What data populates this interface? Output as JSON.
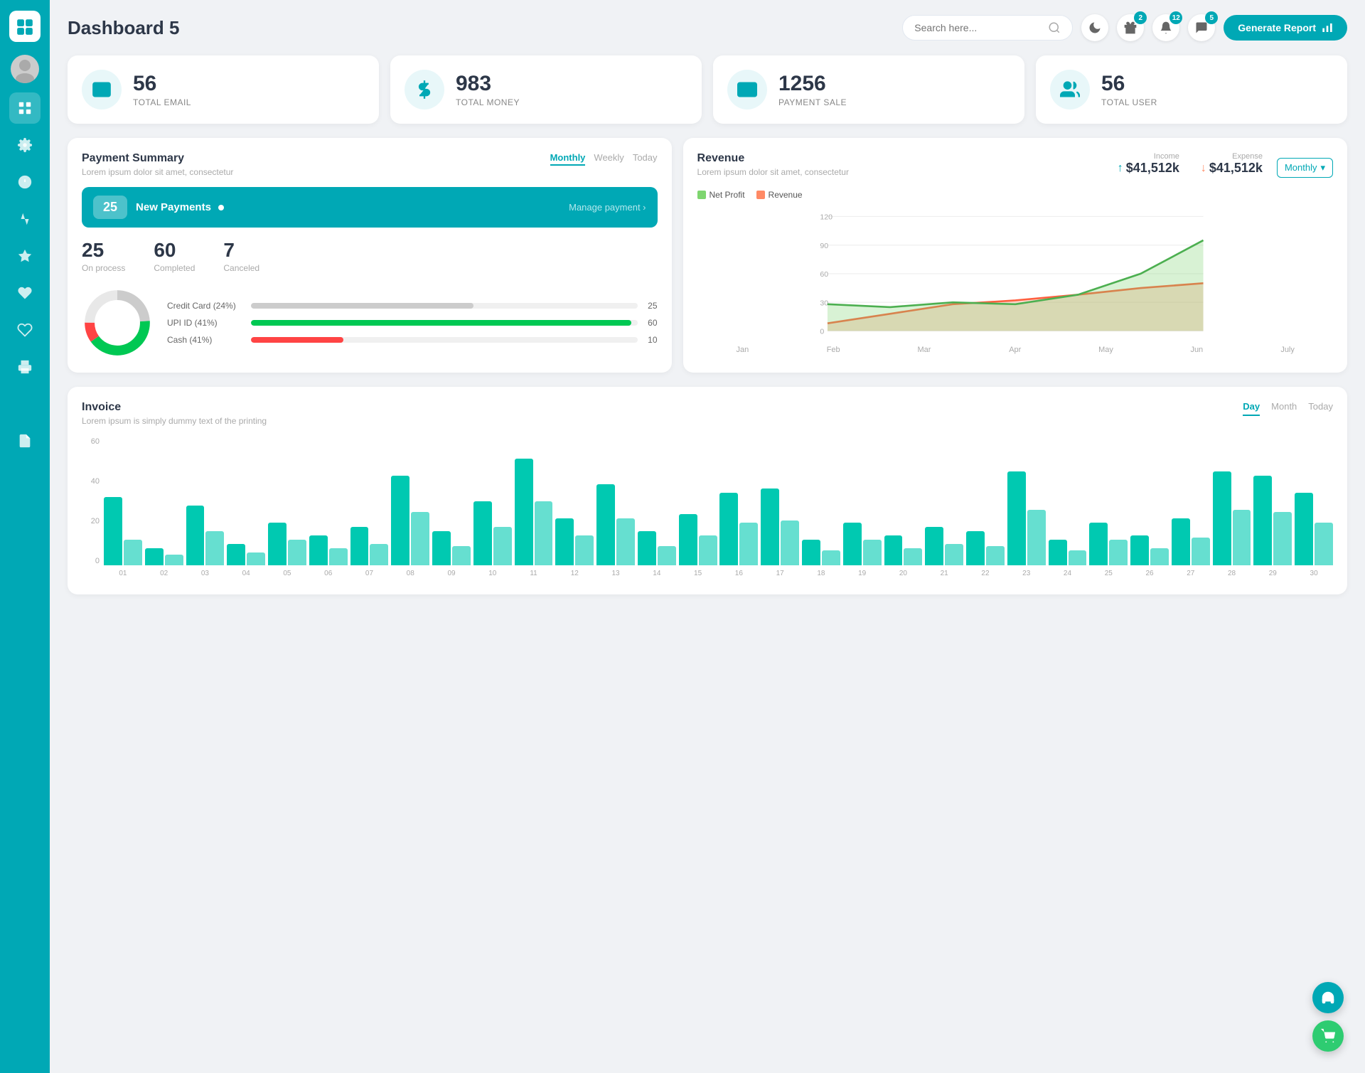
{
  "app": {
    "title": "Dashboard 5"
  },
  "header": {
    "search_placeholder": "Search here...",
    "generate_btn": "Generate Report",
    "badges": {
      "gift": "2",
      "bell": "12",
      "chat": "5"
    }
  },
  "stats": [
    {
      "id": "email",
      "number": "56",
      "label": "TOTAL EMAIL",
      "icon": "email"
    },
    {
      "id": "money",
      "number": "983",
      "label": "TOTAL MONEY",
      "icon": "dollar"
    },
    {
      "id": "payment",
      "number": "1256",
      "label": "PAYMENT SALE",
      "icon": "card"
    },
    {
      "id": "user",
      "number": "56",
      "label": "TOTAL USER",
      "icon": "user"
    }
  ],
  "payment_summary": {
    "title": "Payment Summary",
    "subtitle": "Lorem ipsum dolor sit amet, consectetur",
    "tabs": [
      "Monthly",
      "Weekly",
      "Today"
    ],
    "active_tab": "Monthly",
    "new_payments": {
      "count": "25",
      "label": "New Payments",
      "link": "Manage payment"
    },
    "metrics": [
      {
        "value": "25",
        "label": "On process"
      },
      {
        "value": "60",
        "label": "Completed"
      },
      {
        "value": "7",
        "label": "Canceled"
      }
    ],
    "progress_items": [
      {
        "label": "Credit Card (24%)",
        "color": "#cccccc",
        "pct": 24,
        "value": "25"
      },
      {
        "label": "UPI ID (41%)",
        "color": "#00c853",
        "pct": 41,
        "value": "60"
      },
      {
        "label": "Cash (41%)",
        "color": "#ff4444",
        "pct": 10,
        "value": "10"
      }
    ],
    "donut": {
      "segments": [
        {
          "color": "#cccccc",
          "pct": 24
        },
        {
          "color": "#00c853",
          "pct": 41
        },
        {
          "color": "#ff4444",
          "pct": 10
        },
        {
          "color": "#e8e8e8",
          "pct": 25
        }
      ]
    }
  },
  "revenue": {
    "title": "Revenue",
    "subtitle": "Lorem ipsum dolor sit amet, consectetur",
    "filter": "Monthly",
    "income": {
      "label": "Income",
      "value": "$41,512k"
    },
    "expense": {
      "label": "Expense",
      "value": "$41,512k"
    },
    "legend": [
      {
        "label": "Net Profit",
        "color": "#7ed56f"
      },
      {
        "label": "Revenue",
        "color": "#ff8a65"
      }
    ],
    "x_labels": [
      "Jan",
      "Feb",
      "Mar",
      "Apr",
      "May",
      "Jun",
      "July"
    ],
    "y_labels": [
      "120",
      "90",
      "60",
      "30",
      "0"
    ],
    "net_profit_points": [
      28,
      25,
      30,
      28,
      38,
      60,
      95
    ],
    "revenue_points": [
      8,
      18,
      28,
      32,
      38,
      45,
      50
    ]
  },
  "invoice": {
    "title": "Invoice",
    "subtitle": "Lorem ipsum is simply dummy text of the printing",
    "tabs": [
      "Day",
      "Month",
      "Today"
    ],
    "active_tab": "Day",
    "y_labels": [
      "60",
      "40",
      "20",
      "0"
    ],
    "x_labels": [
      "01",
      "02",
      "03",
      "04",
      "05",
      "06",
      "07",
      "08",
      "09",
      "10",
      "11",
      "12",
      "13",
      "14",
      "15",
      "16",
      "17",
      "18",
      "19",
      "20",
      "21",
      "22",
      "23",
      "24",
      "25",
      "26",
      "27",
      "28",
      "29",
      "30"
    ],
    "bar_data": [
      [
        32,
        12
      ],
      [
        8,
        5
      ],
      [
        28,
        16
      ],
      [
        10,
        6
      ],
      [
        20,
        12
      ],
      [
        14,
        8
      ],
      [
        18,
        10
      ],
      [
        42,
        25
      ],
      [
        16,
        9
      ],
      [
        30,
        18
      ],
      [
        50,
        30
      ],
      [
        22,
        14
      ],
      [
        38,
        22
      ],
      [
        16,
        9
      ],
      [
        24,
        14
      ],
      [
        34,
        20
      ],
      [
        36,
        21
      ],
      [
        12,
        7
      ],
      [
        20,
        12
      ],
      [
        14,
        8
      ],
      [
        18,
        10
      ],
      [
        16,
        9
      ],
      [
        44,
        26
      ],
      [
        12,
        7
      ],
      [
        20,
        12
      ],
      [
        14,
        8
      ],
      [
        22,
        13
      ],
      [
        44,
        26
      ],
      [
        42,
        25
      ],
      [
        34,
        20
      ]
    ]
  }
}
